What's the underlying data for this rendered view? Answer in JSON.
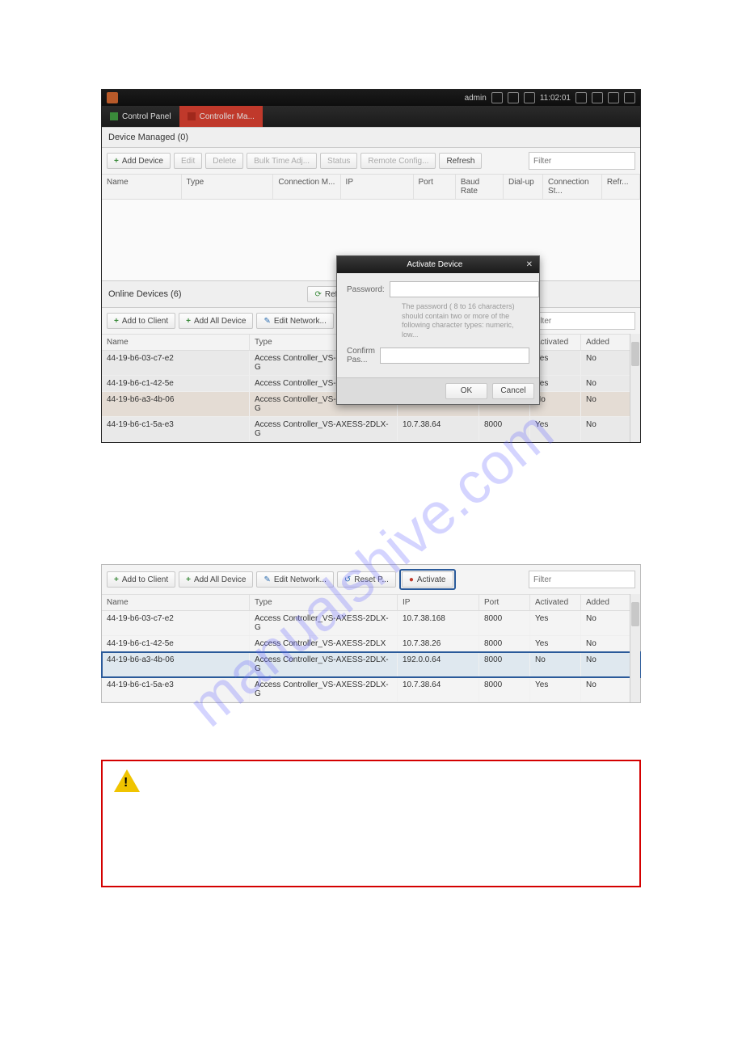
{
  "watermark": "manualshive.com",
  "titlebar": {
    "user": "admin",
    "time": "11:02:01"
  },
  "tabs": [
    "Control Panel",
    "Controller Ma..."
  ],
  "filter_placeholder": "Filter",
  "managed": {
    "header": "Device Managed (0)",
    "toolbar": {
      "add": "Add Device",
      "edit": "Edit",
      "delete": "Delete",
      "bulk": "Bulk Time Adj...",
      "status": "Status",
      "remote": "Remote Config...",
      "refresh": "Refresh"
    },
    "cols": [
      "Name",
      "Type",
      "Connection M...",
      "IP",
      "Port",
      "Baud Rate",
      "Dial-up",
      "Connection St...",
      "Refr..."
    ]
  },
  "online": {
    "header": "Online Devices (6)",
    "refresh": "Refresh",
    "toolbar": {
      "add_client": "Add to Client",
      "add_all": "Add All Device",
      "edit_net": "Edit Network...",
      "reset": "Reset P...",
      "activate": "Activate"
    },
    "cols": [
      "Name",
      "Type",
      "IP",
      "Port",
      "Activated",
      "Added"
    ],
    "rows": [
      {
        "name": "44-19-b6-03-c7-e2",
        "type": "Access Controller_VS-AXESS-2DLX-G",
        "ip": "10.7.38.168",
        "port": "8000",
        "activated": "Yes",
        "added": "No"
      },
      {
        "name": "44-19-b6-c1-42-5e",
        "type": "Access Controller_VS-AXESS-2DLX",
        "ip": "10.7.38.26",
        "port": "8000",
        "activated": "Yes",
        "added": "No"
      },
      {
        "name": "44-19-b6-a3-4b-06",
        "type": "Access Controller_VS-AXESS-2DLX-G",
        "ip": "192.0.0.64",
        "port": "8000",
        "activated": "No",
        "added": "No"
      },
      {
        "name": "44-19-b6-c1-5a-e3",
        "type": "Access Controller_VS-AXESS-2DLX-G",
        "ip": "10.7.38.64",
        "port": "8000",
        "activated": "Yes",
        "added": "No"
      }
    ]
  },
  "dialog": {
    "title": "Activate Device",
    "password_label": "Password:",
    "confirm_label": "Confirm Pas...",
    "hint": "The password ( 8 to 16 characters) should contain two or more of the following character types: numeric, low...",
    "ok": "OK",
    "cancel": "Cancel"
  }
}
